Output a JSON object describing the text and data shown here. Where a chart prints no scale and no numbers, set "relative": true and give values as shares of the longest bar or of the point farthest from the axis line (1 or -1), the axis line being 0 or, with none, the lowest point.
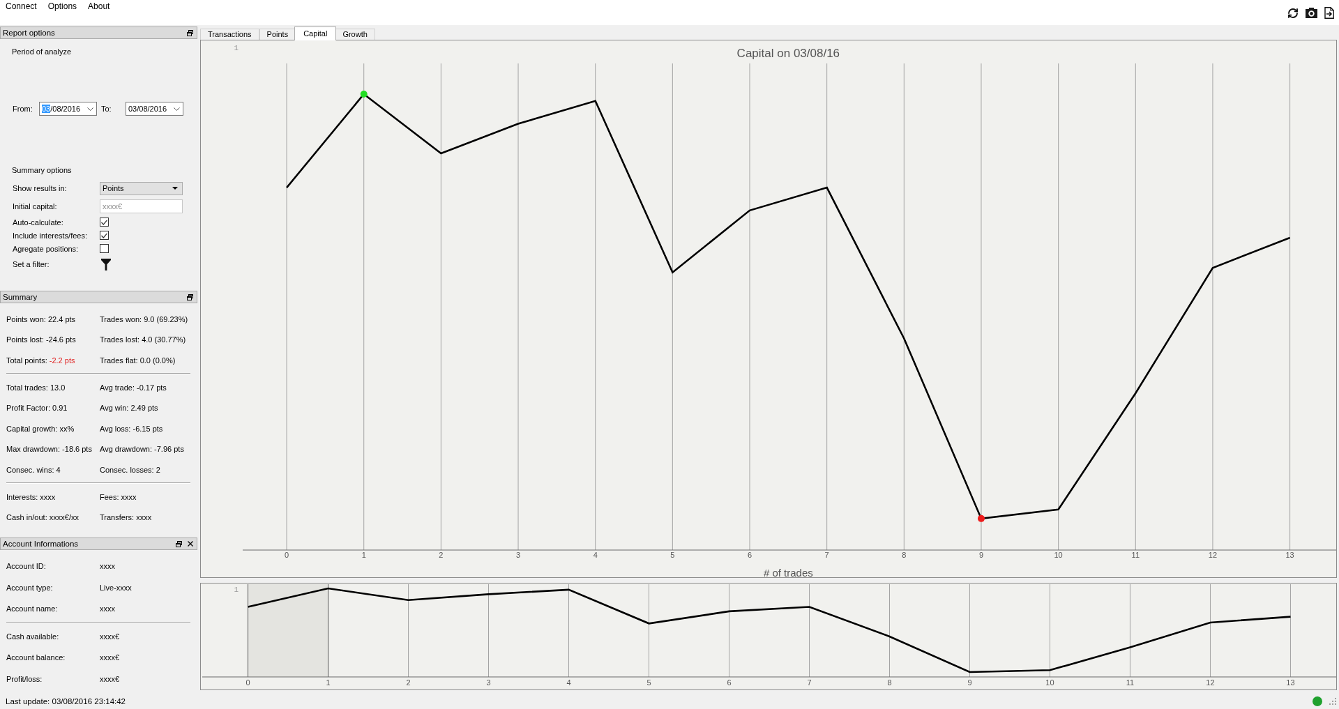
{
  "menu": [
    "Connect",
    "Options",
    "About"
  ],
  "report_options": {
    "title": "Report options",
    "closable": false,
    "period_heading": "Period of analyze",
    "from": {
      "label": "From:",
      "value": "03/08/2016",
      "focused": true
    },
    "to": {
      "label": "To:",
      "value": "03/08/2016",
      "focused": false
    },
    "summary_heading": "Summary options",
    "rows": [
      {
        "kind": "select",
        "label": "Show results in:",
        "value": "Points"
      },
      {
        "kind": "input",
        "label": "Initial capital:",
        "placeholder": "xxxx€"
      },
      {
        "kind": "checkbox",
        "label": "Auto-calculate:",
        "checked": true
      },
      {
        "kind": "checkbox",
        "label": "Include interests/fees:",
        "checked": true
      },
      {
        "kind": "checkbox",
        "label": "Agregate positions:",
        "checked": false
      },
      {
        "kind": "filter",
        "label": "Set a filter:"
      }
    ]
  },
  "summary": {
    "title": "Summary",
    "closable": false,
    "groups": [
      {
        "rows": [
          [
            {
              "label": "Points won:",
              "value": "22.4 pts",
              "alert": false
            },
            {
              "label": "Trades won:",
              "value": "9.0 (69.23%)",
              "alert": false
            }
          ],
          [
            {
              "label": "Points lost:",
              "value": "-24.6 pts",
              "alert": false
            },
            {
              "label": "Trades lost:",
              "value": "4.0 (30.77%)",
              "alert": false
            }
          ],
          [
            {
              "label": "Total points:",
              "value": "-2.2 pts",
              "alert": true
            },
            {
              "label": "Trades flat:",
              "value": "0.0 (0.0%)",
              "alert": false
            }
          ]
        ]
      },
      {
        "rows": [
          [
            {
              "label": "Total trades:",
              "value": "13.0",
              "alert": false
            },
            {
              "label": "Avg trade:",
              "value": "-0.17 pts",
              "alert": false
            }
          ],
          [
            {
              "label": "Profit Factor:",
              "value": "0.91",
              "alert": false
            },
            {
              "label": "Avg win:",
              "value": "2.49 pts",
              "alert": false
            }
          ],
          [
            {
              "label": "Capital growth:",
              "value": "xx%",
              "alert": false
            },
            {
              "label": "Avg loss:",
              "value": "-6.15 pts",
              "alert": false
            }
          ],
          [
            {
              "label": "Max drawdown:",
              "value": "-18.6 pts",
              "alert": false
            },
            {
              "label": "Avg drawdown:",
              "value": "-7.96 pts",
              "alert": false
            }
          ],
          [
            {
              "label": "Consec. wins:",
              "value": "4",
              "alert": false
            },
            {
              "label": "Consec. losses:",
              "value": "2",
              "alert": false
            }
          ]
        ]
      },
      {
        "rows": [
          [
            {
              "label": "Interests:",
              "value": "xxxx",
              "alert": false
            },
            {
              "label": "Fees:",
              "value": "xxxx",
              "alert": false
            }
          ],
          [
            {
              "label": "Cash in/out:",
              "value": "xxxx€/xx",
              "alert": false
            },
            {
              "label": "Transfers:",
              "value": "xxxx",
              "alert": false
            }
          ]
        ]
      }
    ]
  },
  "account": {
    "title": "Account Informations",
    "closable": true,
    "groups": [
      {
        "rows": [
          {
            "label": "Account ID:",
            "value": "xxxx"
          },
          {
            "label": "Account type:",
            "value": "Live-xxxx"
          },
          {
            "label": "Account name:",
            "value": "xxxx"
          }
        ]
      },
      {
        "rows": [
          {
            "label": "Cash available:",
            "value": "xxxx€"
          },
          {
            "label": "Account balance:",
            "value": "xxxx€"
          },
          {
            "label": "Profit/loss:",
            "value": "xxxx€"
          }
        ]
      }
    ]
  },
  "tabs": [
    {
      "label": "Transactions",
      "selected": false
    },
    {
      "label": "Points",
      "selected": false
    },
    {
      "label": "Capital",
      "selected": true
    },
    {
      "label": "Growth",
      "selected": false
    }
  ],
  "capital_chart": {
    "corner_label": "1",
    "markers": [
      {
        "kind": "high",
        "color": "#22dd22"
      },
      {
        "kind": "low",
        "color": "#ee1c1c"
      }
    ],
    "chart_data": {
      "type": "line",
      "title": "Capital on 03/08/16",
      "xlabel": "# of trades",
      "relative": true,
      "grid": true,
      "x": [
        0,
        1,
        2,
        3,
        4,
        5,
        6,
        7,
        8,
        9,
        10,
        11,
        12,
        13
      ],
      "xlim": [
        -0.57,
        13.6
      ],
      "xticks": [
        0,
        1,
        2,
        3,
        4,
        5,
        6,
        7,
        8,
        9,
        10,
        11,
        12,
        13
      ],
      "series": [
        {
          "color": "#000000",
          "values": [
            0.795,
            1,
            0.87,
            0.935,
            0.985,
            0.609,
            0.745,
            0.795,
            0.464,
            0.069,
            0.089,
            0.344,
            0.619,
            0.685
          ]
        }
      ]
    }
  },
  "overview_chart": {
    "corner_label": "1",
    "chart_data": {
      "type": "line",
      "relative": true,
      "grid": true,
      "x": [
        0,
        1,
        2,
        3,
        4,
        5,
        6,
        7,
        8,
        9,
        10,
        11,
        12,
        13
      ],
      "xlim": [
        -0.57,
        13.57
      ],
      "xticks": [
        0,
        1,
        2,
        3,
        4,
        5,
        6,
        7,
        8,
        9,
        10,
        11,
        12,
        13
      ],
      "series": [
        {
          "color": "#000000",
          "values": [
            0.791,
            1,
            0.868,
            0.934,
            0.985,
            0.604,
            0.741,
            0.791,
            0.457,
            0.055,
            0.076,
            0.335,
            0.614,
            0.68
          ]
        }
      ],
      "bands": [
        {
          "axis": "x",
          "from": 0,
          "to": 1
        }
      ]
    }
  },
  "status_bar": {
    "text": "Last update: 03/08/2016 23:14:42",
    "connected": true
  }
}
